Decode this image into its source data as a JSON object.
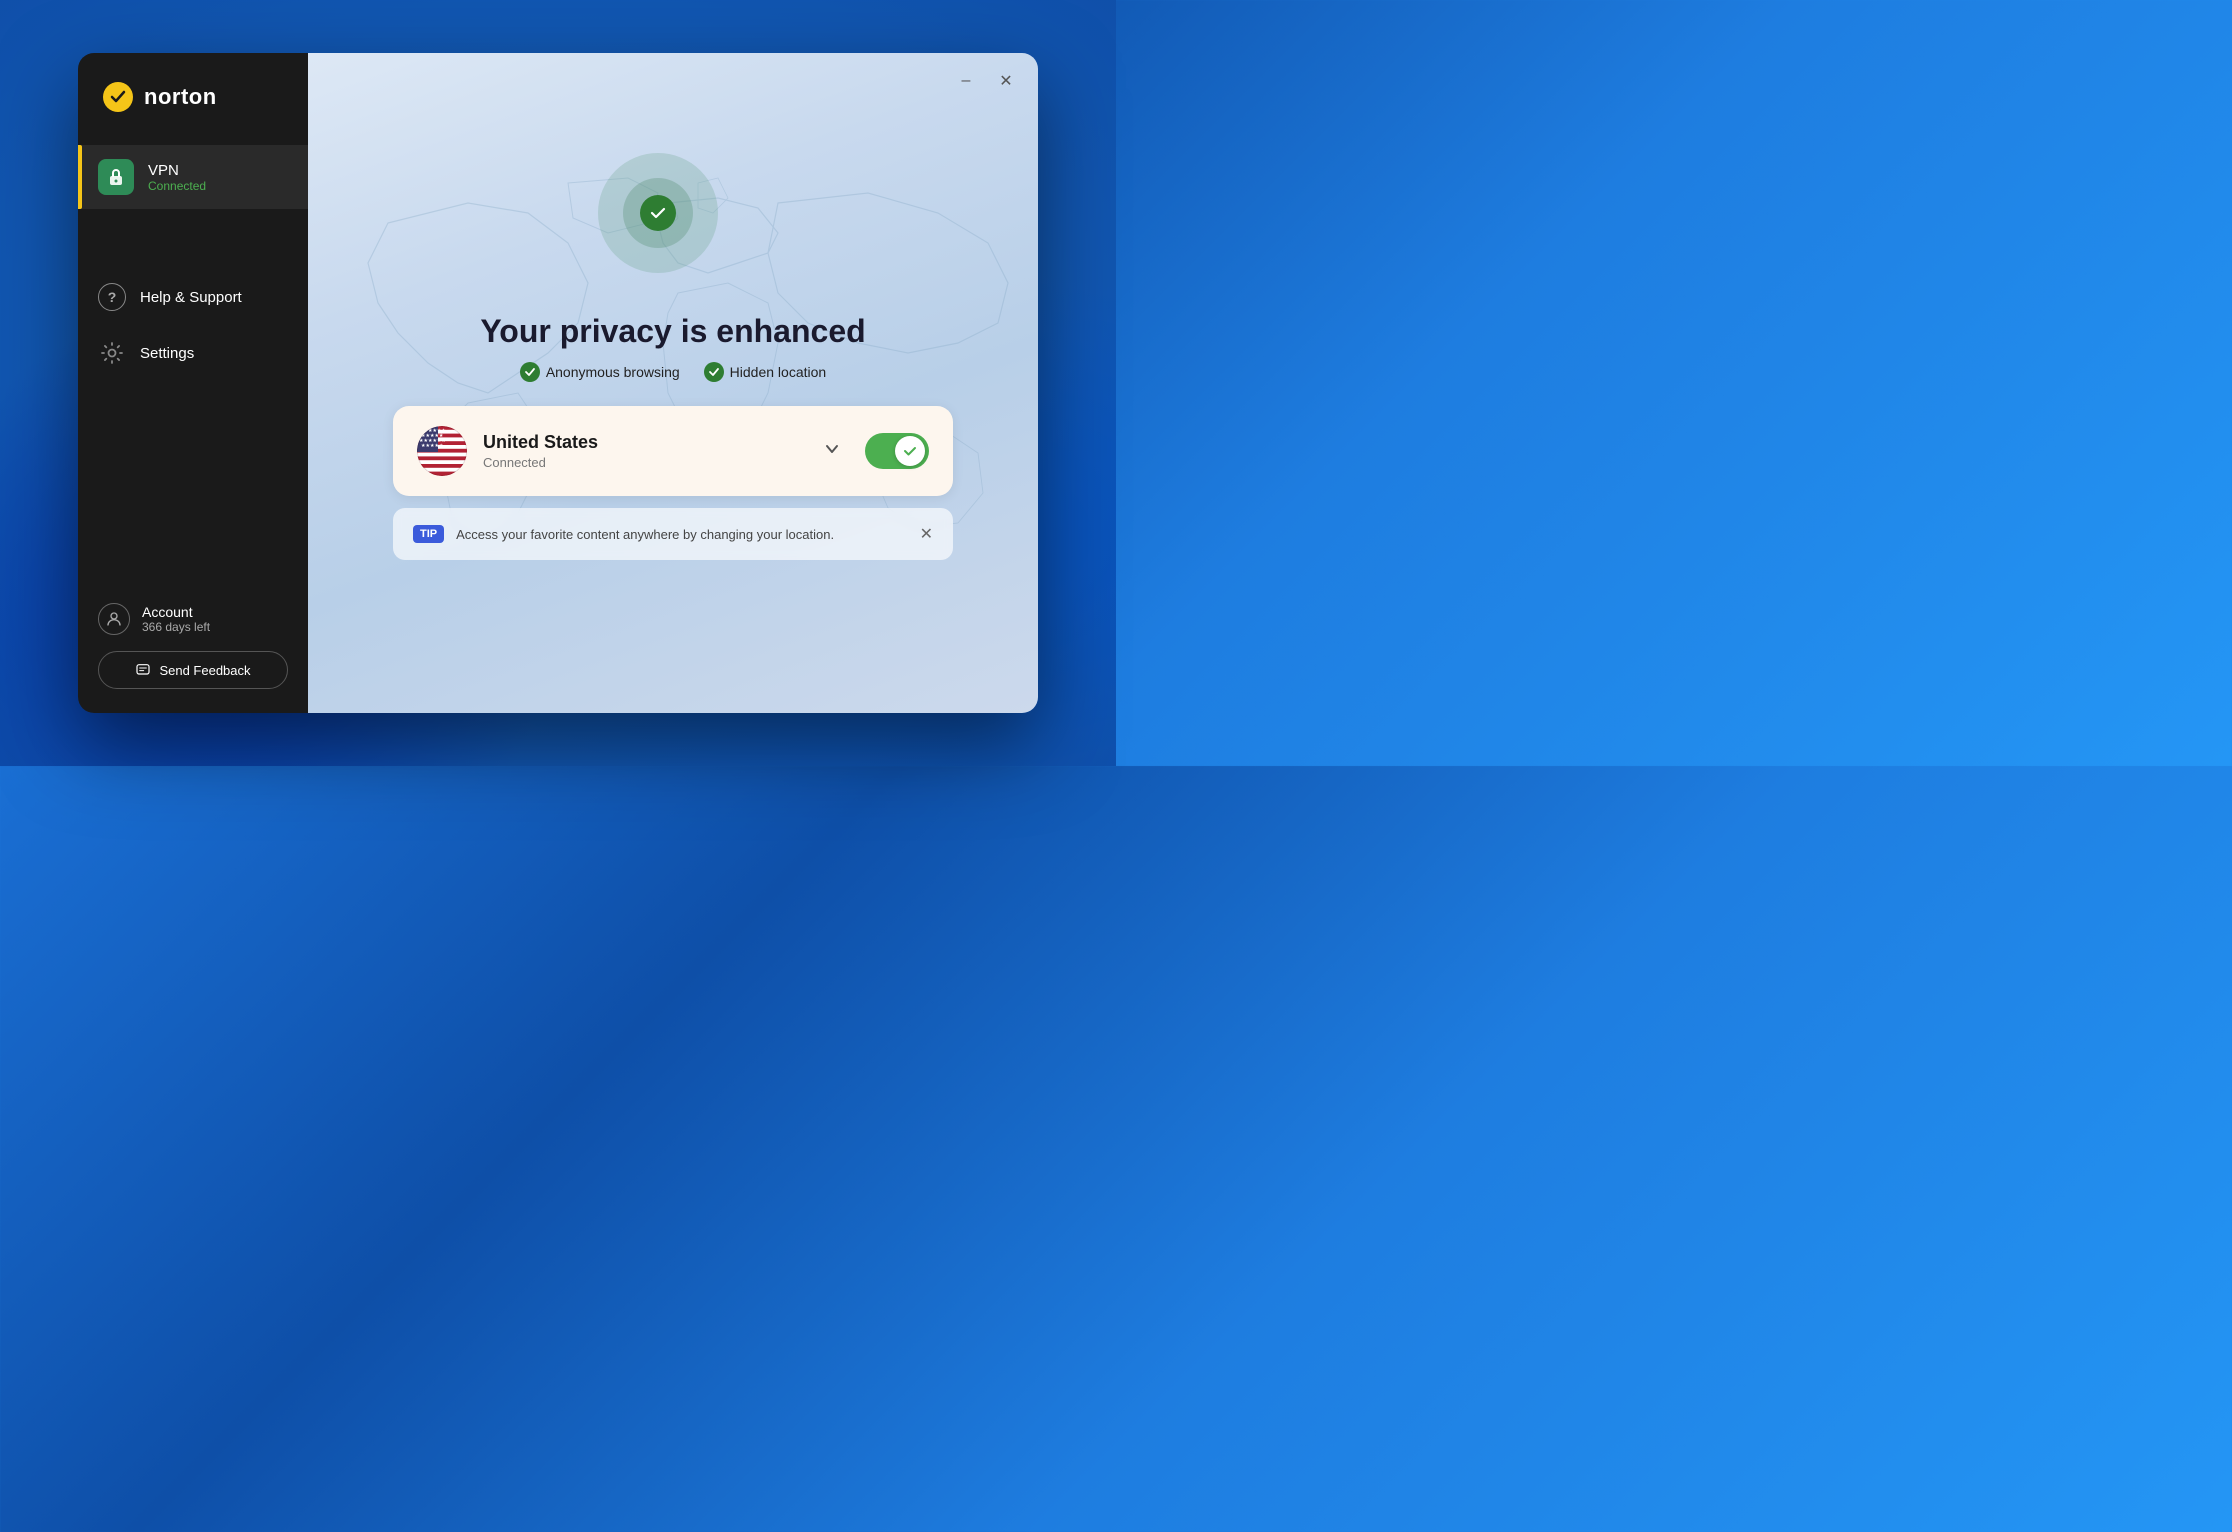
{
  "app": {
    "title": "Norton",
    "logo_text": "norton"
  },
  "sidebar": {
    "nav_items": [
      {
        "id": "vpn",
        "label": "VPN",
        "sublabel": "Connected",
        "active": true,
        "icon": "vpn"
      },
      {
        "id": "help",
        "label": "Help & Support",
        "active": false,
        "icon": "help"
      },
      {
        "id": "settings",
        "label": "Settings",
        "active": false,
        "icon": "gear"
      }
    ],
    "account": {
      "label": "Account",
      "days_left": "366 days left"
    },
    "feedback_button": "Send Feedback"
  },
  "main": {
    "privacy_title": "Your privacy is enhanced",
    "privacy_badges": [
      {
        "text": "Anonymous browsing"
      },
      {
        "text": "Hidden location"
      }
    ],
    "vpn_card": {
      "country": "United States",
      "status": "Connected",
      "toggle_on": true
    },
    "tip": {
      "label": "TIP",
      "text": "Access your favorite content anywhere by changing your location."
    }
  },
  "window_controls": {
    "minimize": "–",
    "close": "✕"
  }
}
